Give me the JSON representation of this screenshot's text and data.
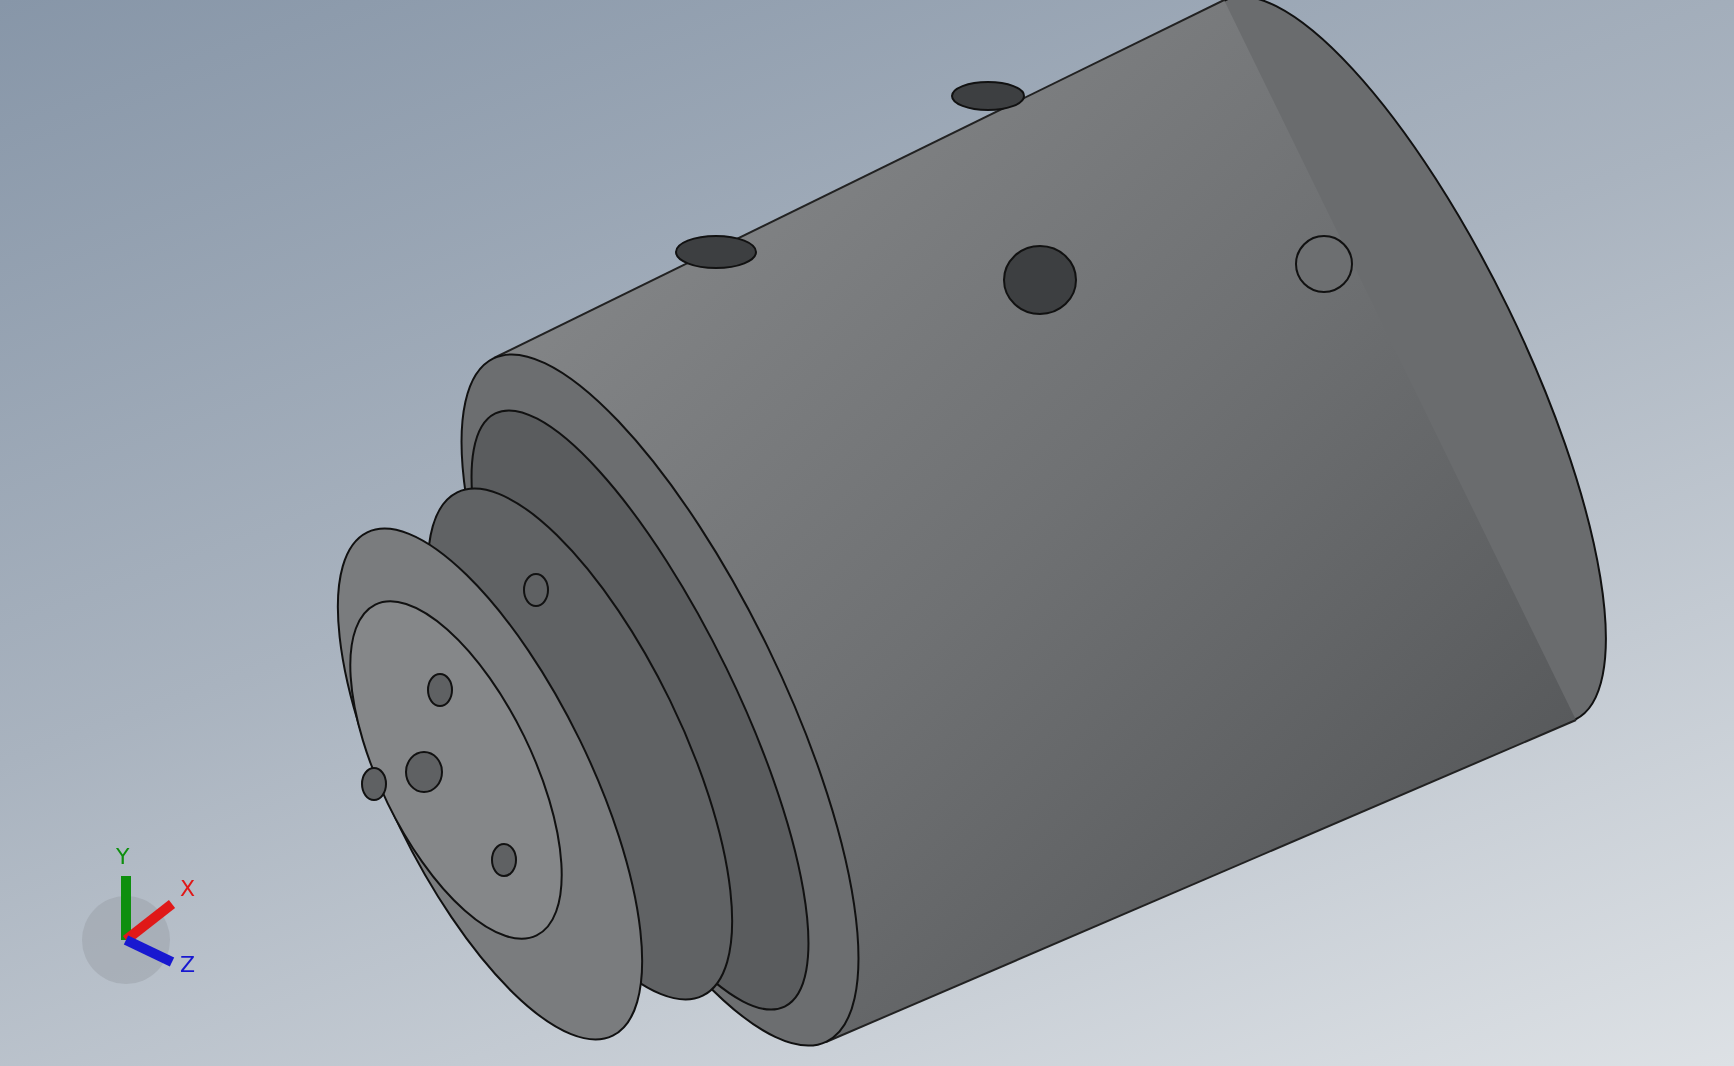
{
  "viewport": {
    "triad": {
      "axes": [
        {
          "kind": "y",
          "label": "Y",
          "color": "#0e8f0e"
        },
        {
          "kind": "x",
          "label": "X",
          "color": "#e01818"
        },
        {
          "kind": "z",
          "label": "Z",
          "color": "#1818d0"
        }
      ]
    }
  }
}
